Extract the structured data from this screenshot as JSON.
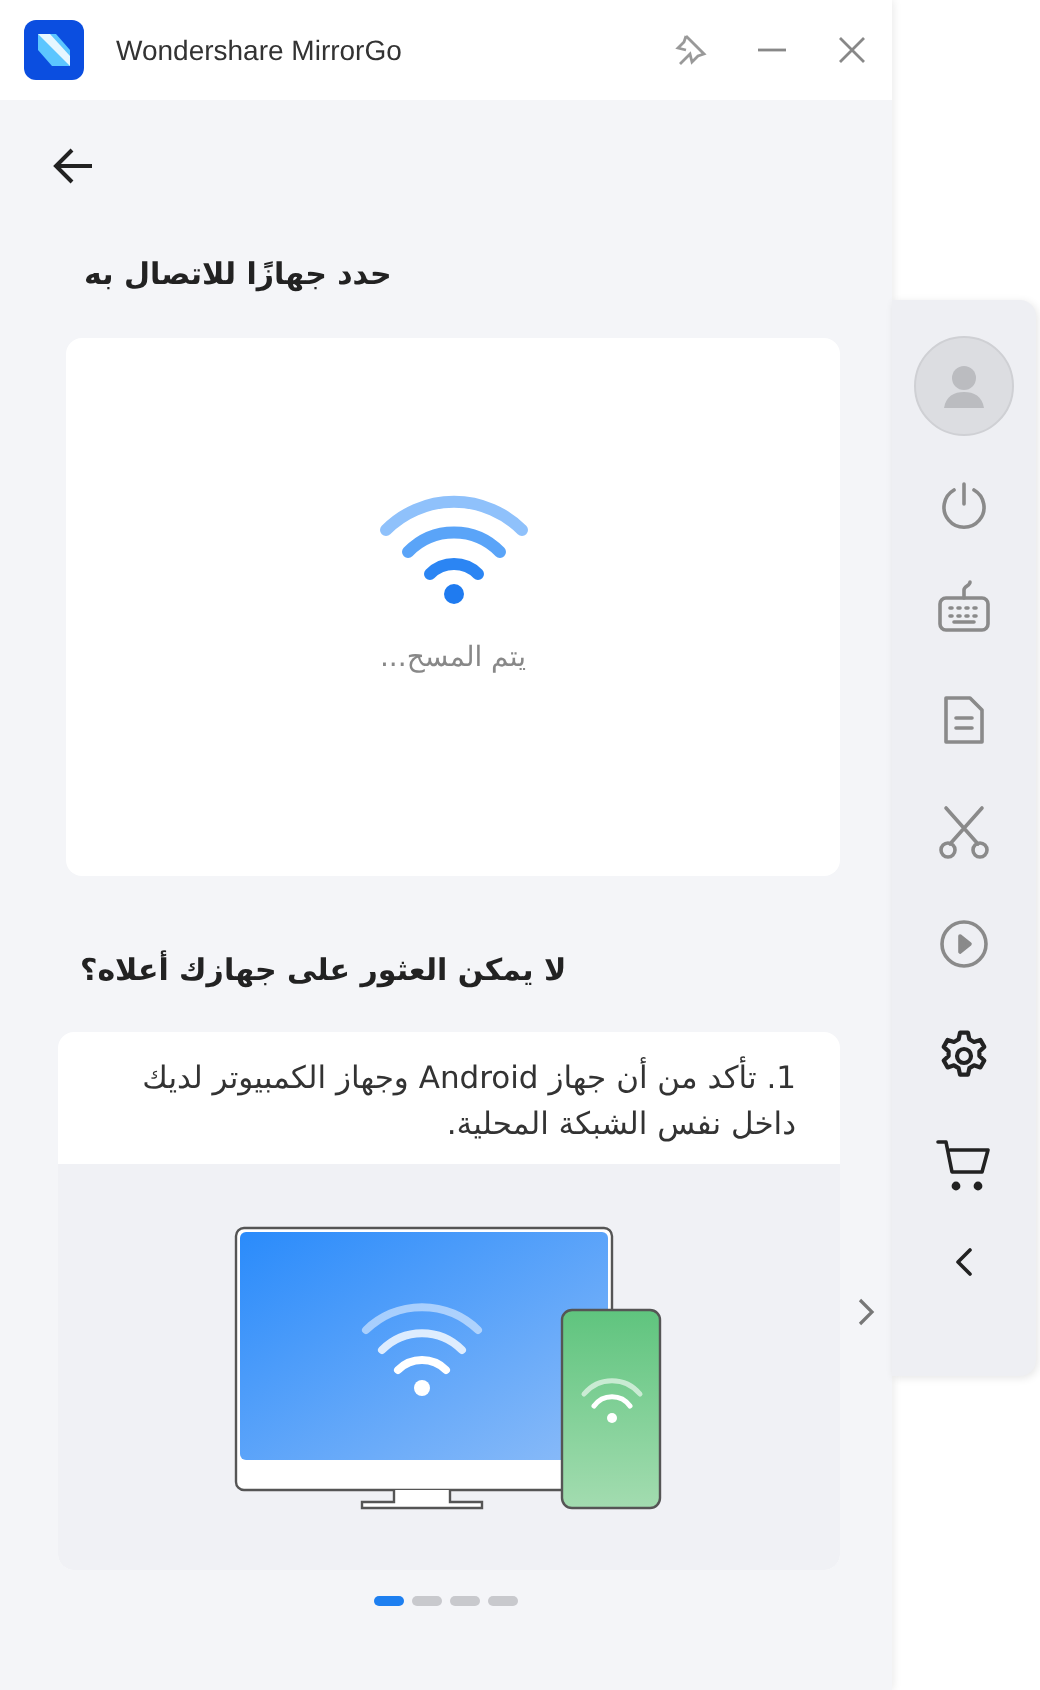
{
  "window": {
    "title": "Wondershare MirrorGo"
  },
  "heading": "حدد جهازًا للاتصال به",
  "scan_status": "يتم المسح...",
  "help_heading": "لا يمكن العثور على جهازك أعلاه؟",
  "tip": {
    "text": "1. تأكد من أن جهاز Android وجهاز الكمبيوتر لديك داخل نفس الشبكة المحلية."
  },
  "pagination": [
    {
      "selected": true
    },
    {
      "selected": false
    },
    {
      "selected": false
    },
    {
      "selected": false
    }
  ],
  "toolbar": [
    {
      "kind": "avatar"
    },
    {
      "kind": "power",
      "disabled": true
    },
    {
      "kind": "keyboard",
      "disabled": true
    },
    {
      "kind": "document",
      "disabled": true
    },
    {
      "kind": "scissors",
      "disabled": true
    },
    {
      "kind": "play",
      "disabled": true
    },
    {
      "kind": "settings",
      "disabled": false
    },
    {
      "kind": "cart",
      "disabled": false
    },
    {
      "kind": "collapse",
      "disabled": false
    }
  ]
}
